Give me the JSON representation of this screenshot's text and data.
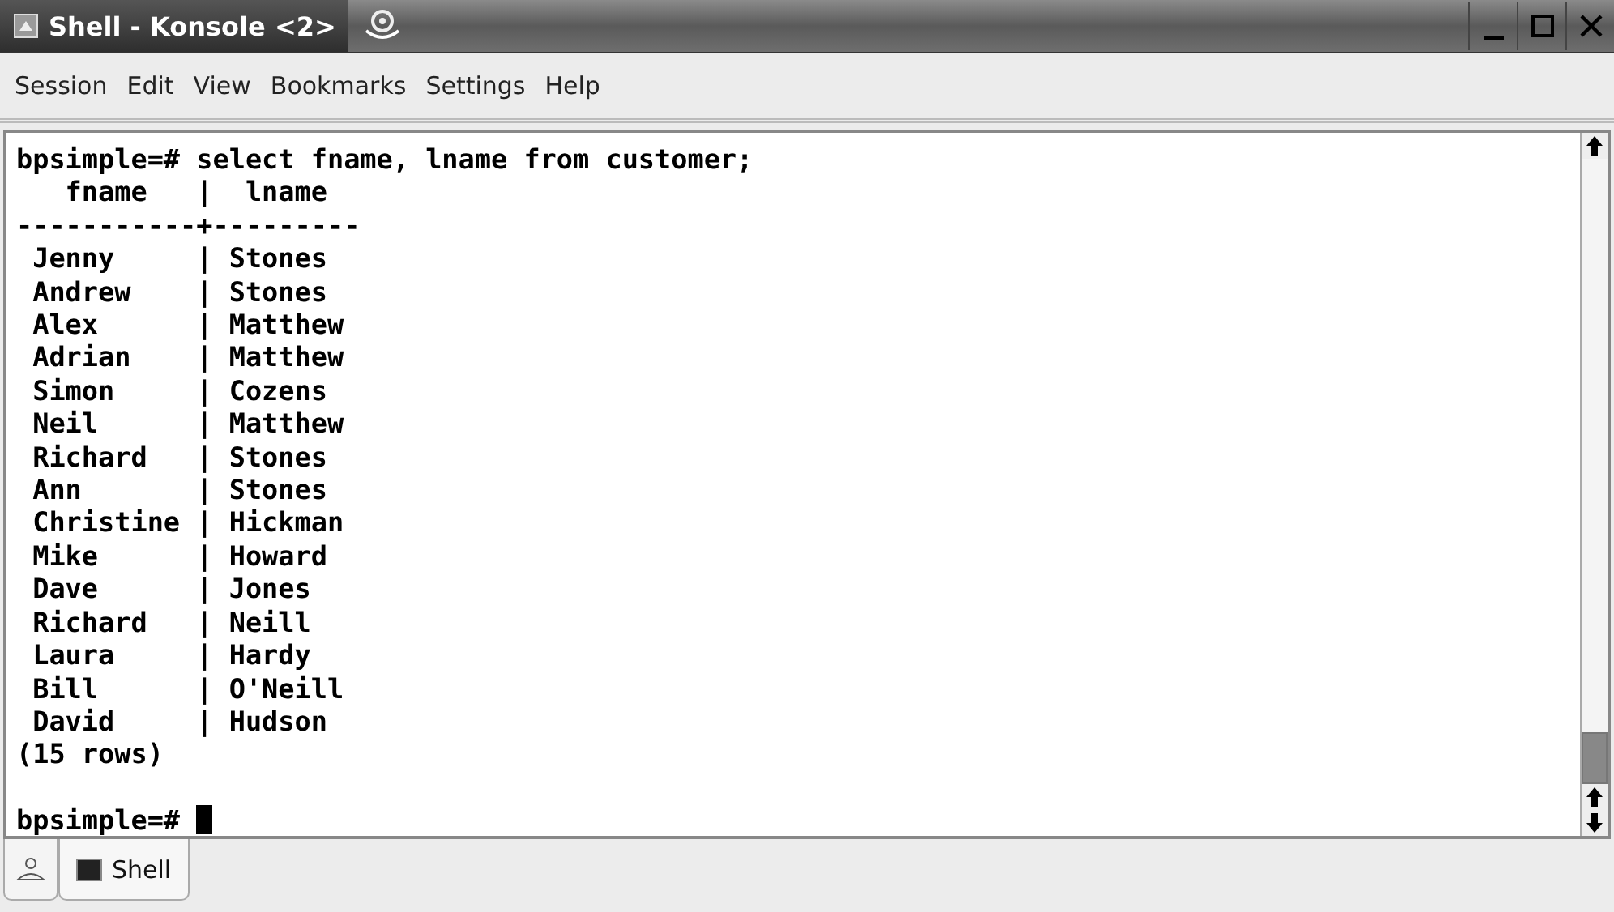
{
  "window": {
    "title": "Shell - Konsole <2>"
  },
  "menu": [
    "Session",
    "Edit",
    "View",
    "Bookmarks",
    "Settings",
    "Help"
  ],
  "terminal": {
    "lines": [
      "bpsimple=# select fname, lname from customer;",
      "   fname   |  lname",
      "-----------+---------",
      " Jenny     | Stones",
      " Andrew    | Stones",
      " Alex      | Matthew",
      " Adrian    | Matthew",
      " Simon     | Cozens",
      " Neil      | Matthew",
      " Richard   | Stones",
      " Ann       | Stones",
      " Christine | Hickman",
      " Mike      | Howard",
      " Dave      | Jones",
      " Richard   | Neill",
      " Laura     | Hardy",
      " Bill      | O'Neill",
      " David     | Hudson",
      "(15 rows)"
    ],
    "prompt": "bpsimple=# "
  },
  "tabs": [
    {
      "label": "Shell",
      "selected": true
    }
  ]
}
